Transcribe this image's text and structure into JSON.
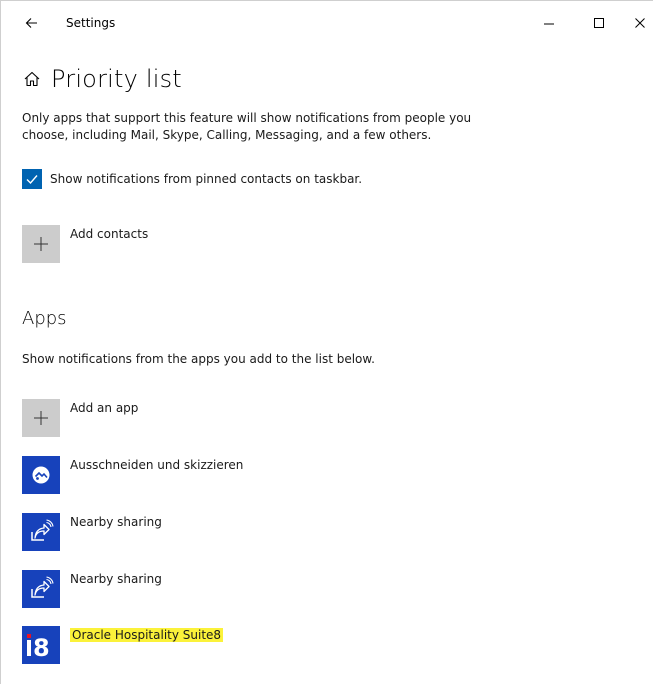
{
  "window": {
    "title": "Settings"
  },
  "page": {
    "title": "Priority list",
    "intro": "Only apps that support this feature will show notifications from people you choose, including Mail, Skype, Calling, Messaging, and a few others."
  },
  "contacts": {
    "checkbox_label": "Show notifications from pinned contacts on taskbar.",
    "checkbox_checked": true,
    "add_label": "Add contacts"
  },
  "apps": {
    "title": "Apps",
    "description": "Show notifications from the apps you add to the list below.",
    "add_label": "Add an app",
    "items": [
      {
        "name": "Ausschneiden und skizzieren",
        "icon": "snip-sketch-icon"
      },
      {
        "name": "Nearby sharing",
        "icon": "nearby-sharing-icon"
      },
      {
        "name": "Nearby sharing",
        "icon": "nearby-sharing-icon"
      },
      {
        "name": "Oracle Hospitality Suite8",
        "icon": "suite8-icon",
        "highlighted": true
      }
    ]
  },
  "colors": {
    "accent": "#0063b1",
    "tile_blue": "#1742bb",
    "tile_gray": "#cccccc",
    "highlight": "#fbf23a"
  }
}
